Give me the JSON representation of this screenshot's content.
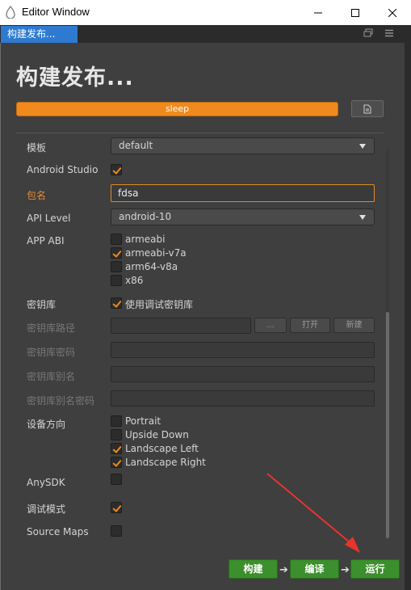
{
  "window": {
    "title": "Editor Window",
    "icon": "app-icon"
  },
  "tab": {
    "label": "构建发布..."
  },
  "panel": {
    "title": "构建发布...",
    "progress": {
      "label": "sleep",
      "fraction": 1.0
    }
  },
  "form": {
    "template": {
      "label": "模板",
      "value": "default"
    },
    "android_studio": {
      "label": "Android Studio",
      "checked": true
    },
    "package_name": {
      "label": "包名",
      "value": "fdsa"
    },
    "api_level": {
      "label": "API Level",
      "value": "android-10"
    },
    "app_abi": {
      "label": "APP ABI",
      "options": [
        {
          "label": "armeabi",
          "checked": false
        },
        {
          "label": "armeabi-v7a",
          "checked": true
        },
        {
          "label": "arm64-v8a",
          "checked": false
        },
        {
          "label": "x86",
          "checked": false
        }
      ]
    },
    "keystore": {
      "label": "密钥库",
      "option_label": "使用调试密钥库",
      "checked": true
    },
    "keystore_path": {
      "label": "密钥库路径",
      "browse": "...",
      "open": "打开",
      "new": "新建"
    },
    "keystore_password": {
      "label": "密钥库密码"
    },
    "keystore_alias": {
      "label": "密钥库别名"
    },
    "keystore_alias_password": {
      "label": "密钥库别名密码"
    },
    "orientation": {
      "label": "设备方向",
      "options": [
        {
          "label": "Portrait",
          "checked": false
        },
        {
          "label": "Upside Down",
          "checked": false
        },
        {
          "label": "Landscape Left",
          "checked": true
        },
        {
          "label": "Landscape Right",
          "checked": true
        }
      ]
    },
    "anysdk": {
      "label": "AnySDK",
      "checked": false
    },
    "debug_mode": {
      "label": "调试模式",
      "checked": true
    },
    "source_maps": {
      "label": "Source Maps",
      "checked": false
    }
  },
  "actions": {
    "build": "构建",
    "compile": "编译",
    "run": "运行"
  },
  "colors": {
    "accent": "#f08a1c",
    "action": "#3b8f2c",
    "tab": "#2f7ad1",
    "annotation": "#e8352b"
  }
}
